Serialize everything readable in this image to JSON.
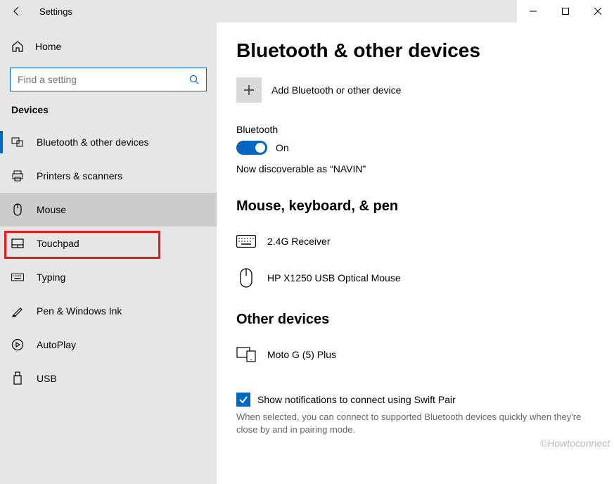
{
  "window": {
    "title": "Settings"
  },
  "sidebar": {
    "home_label": "Home",
    "search_placeholder": "Find a setting",
    "category_label": "Devices",
    "items": [
      {
        "label": "Bluetooth & other devices"
      },
      {
        "label": "Printers & scanners"
      },
      {
        "label": "Mouse"
      },
      {
        "label": "Touchpad"
      },
      {
        "label": "Typing"
      },
      {
        "label": "Pen & Windows Ink"
      },
      {
        "label": "AutoPlay"
      },
      {
        "label": "USB"
      }
    ]
  },
  "main": {
    "page_title": "Bluetooth & other devices",
    "add_device_label": "Add Bluetooth or other device",
    "bluetooth": {
      "label": "Bluetooth",
      "state_label": "On",
      "discoverable_text": "Now discoverable as “NAVIN”"
    },
    "sections": [
      {
        "title": "Mouse, keyboard, & pen",
        "devices": [
          {
            "name": "2.4G Receiver",
            "icon": "keyboard"
          },
          {
            "name": "HP X1250 USB Optical Mouse",
            "icon": "mouse"
          }
        ]
      },
      {
        "title": "Other devices",
        "devices": [
          {
            "name": "Moto G (5) Plus",
            "icon": "phone-tablet"
          }
        ]
      }
    ],
    "swift_pair": {
      "checkbox_label": "Show notifications to connect using Swift Pair",
      "checked": true,
      "helper_text": "When selected, you can connect to supported Bluetooth devices quickly when they're close by and in pairing mode."
    }
  },
  "watermark": "©Howtoconnect"
}
